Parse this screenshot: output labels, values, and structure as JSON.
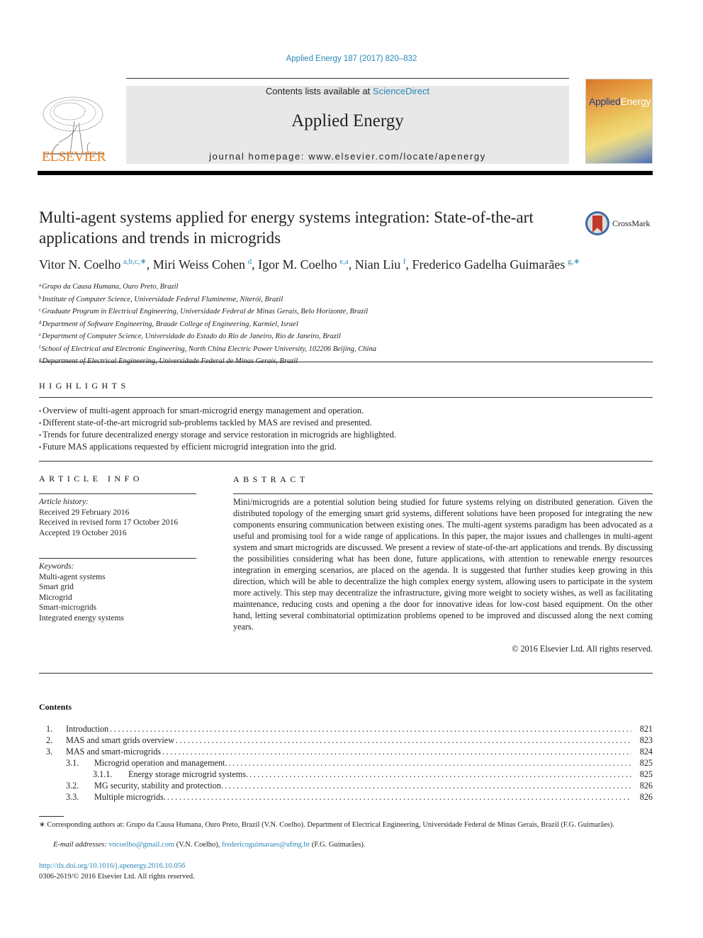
{
  "citation": "Applied Energy 187 (2017) 820–832",
  "header": {
    "contents_prefix": "Contents lists available at ",
    "contents_link": "ScienceDirect",
    "journal_name": "Applied Energy",
    "homepage": "journal homepage: www.elsevier.com/locate/apenergy",
    "publisher": "ELSEVIER",
    "cover_title_a": "Applied",
    "cover_title_b": "Energy"
  },
  "crossmark_label": "CrossMark",
  "title": "Multi-agent systems applied for energy systems integration: State-of-the-art applications and trends in microgrids",
  "authors": [
    {
      "name": "Vitor N. Coelho",
      "sup": "a,b,c,∗",
      "sep": ", "
    },
    {
      "name": "Miri Weiss Cohen",
      "sup": "d",
      "sep": ", "
    },
    {
      "name": "Igor M. Coelho",
      "sup": "e,a",
      "sep": ", "
    },
    {
      "name": "Nian Liu",
      "sup": "f",
      "sep": ", "
    },
    {
      "name": "Frederico Gadelha Guimarães",
      "sup": "g,∗",
      "sep": ""
    }
  ],
  "affiliations": [
    {
      "key": "a",
      "text": "Grupo da Causa Humana, Ouro Preto, Brazil"
    },
    {
      "key": "b",
      "text": "Institute of Computer Science, Universidade Federal Fluminense, Niterói, Brazil"
    },
    {
      "key": "c",
      "text": "Graduate Program in Electrical Engineering, Universidade Federal de Minas Gerais, Belo Horizonte, Brazil"
    },
    {
      "key": "d",
      "text": "Department of Software Engineering, Braude College of Engineering, Karmiel, Israel"
    },
    {
      "key": "e",
      "text": "Department of Computer Science, Universidade do Estado do Rio de Janeiro, Rio de Janeiro, Brazil"
    },
    {
      "key": "f",
      "text": "School of Electrical and Electronic Engineering, North China Electric Power University, 102206 Beijing, China"
    },
    {
      "key": "g",
      "text": "Department of Electrical Engineering, Universidade Federal de Minas Gerais, Brazil"
    }
  ],
  "highlights": {
    "heading": "HIGHLIGHTS",
    "items": [
      "Overview of multi-agent approach for smart-microgrid energy management and operation.",
      "Different state-of-the-art microgrid sub-problems tackled by MAS are revised and presented.",
      "Trends for future decentralized energy storage and service restoration in microgrids are highlighted.",
      "Future MAS applications requested by efficient microgrid integration into the grid."
    ]
  },
  "article_info": {
    "heading": "ARTICLE INFO",
    "history_label": "Article history:",
    "history": [
      "Received 29 February 2016",
      "Received in revised form 17 October 2016",
      "Accepted 19 October 2016"
    ],
    "keywords_label": "Keywords:",
    "keywords": [
      "Multi-agent systems",
      "Smart grid",
      "Microgrid",
      "Smart-microgrids",
      "Integrated energy systems"
    ]
  },
  "abstract": {
    "heading": "ABSTRACT",
    "text": "Mini/microgrids are a potential solution being studied for future systems relying on distributed genera­tion. Given the distributed topology of the emerging smart grid systems, different solutions have been proposed for integrating the new components ensuring communication between existing ones. The multi-agent systems paradigm has been advocated as a useful and promising tool for a wide range of applications. In this paper, the major issues and challenges in multi-agent system and smart microgrids are discussed. We present a review of state-of-the-art applications and trends. By discussing the possibil­ities considering what has been done, future applications, with attention to renewable energy resources integration in emerging scenarios, are placed on the agenda. It is suggested that further studies keep growing in this direction, which will be able to decentralize the high complex energy system, allowing users to participate in the system more actively. This step may decentralize the infrastructure, giving more weight to society wishes, as well as facilitating maintenance, reducing costs and opening a the door for innovative ideas for low-cost based equipment. On the other hand, letting several combinatorial optimization problems opened to be improved and discussed along the next coming years.",
    "copyright": "© 2016 Elsevier Ltd. All rights reserved."
  },
  "contents": {
    "heading": "Contents",
    "items": [
      {
        "num": "1.",
        "title": "Introduction",
        "page": "821",
        "level": 1
      },
      {
        "num": "2.",
        "title": "MAS and smart grids overview",
        "page": "823",
        "level": 1
      },
      {
        "num": "3.",
        "title": "MAS and smart-microgrids",
        "page": "824",
        "level": 1
      },
      {
        "num": "3.1.",
        "title": "Microgrid operation and management.",
        "page": "825",
        "level": 2
      },
      {
        "num": "3.1.1.",
        "title": "Energy storage microgrid systems.",
        "page": "825",
        "level": 3
      },
      {
        "num": "3.2.",
        "title": "MG security, stability and protection.",
        "page": "826",
        "level": 2
      },
      {
        "num": "3.3.",
        "title": "Multiple microgrids.",
        "page": "826",
        "level": 2
      }
    ]
  },
  "footnote": {
    "text": "∗ Corresponding authors at: Grupo da Causa Humana, Ouro Preto, Brazil (V.N. Coelho). Department of Electrical Engineering, Universidade Federal de Minas Gerais, Brazil (F.G. Guimarães).",
    "email_label": "E-mail addresses:",
    "email1": "vncoelho@gmail.com",
    "email1_owner": " (V.N. Coelho), ",
    "email2": "fredericoguimaraes@ufmg.br",
    "email2_owner": " (F.G. Guimarães).",
    "doi": "http://dx.doi.org/10.1016/j.apenergy.2016.10.056",
    "issn": "0306-2619/© 2016 Elsevier Ltd. All rights reserved."
  },
  "colors": {
    "link": "#2a86b8",
    "elsevier_orange": "#f07f1e",
    "header_bg": "#e8e8e8"
  }
}
